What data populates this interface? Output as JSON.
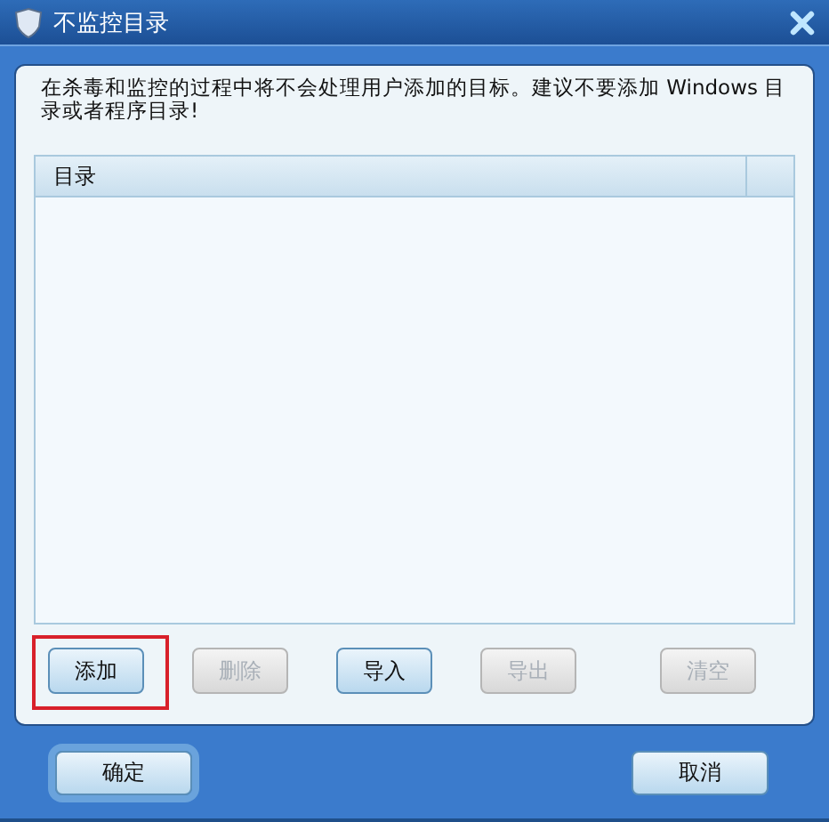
{
  "window": {
    "title": "不监控目录"
  },
  "notice": "在杀毒和监控的过程中将不会处理用户添加的目标。建议不要添加 Windows 目录或者程序目录!",
  "list": {
    "columns": [
      {
        "label": "目录"
      }
    ]
  },
  "buttons": [
    {
      "label": "添加",
      "disabled": false,
      "highlighted": true
    },
    {
      "label": "删除",
      "disabled": true,
      "highlighted": false
    },
    {
      "label": "导入",
      "disabled": false,
      "highlighted": false
    },
    {
      "label": "导出",
      "disabled": true,
      "highlighted": false
    },
    {
      "label": "清空",
      "disabled": true,
      "highlighted": false
    }
  ],
  "footer_buttons": [
    {
      "label": "确定",
      "focused": true
    },
    {
      "label": "取消",
      "focused": false
    }
  ]
}
